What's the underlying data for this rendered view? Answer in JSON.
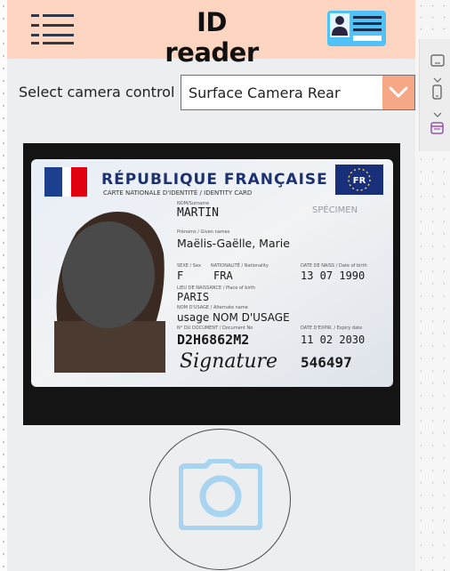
{
  "app": {
    "title": "ID reader"
  },
  "camera": {
    "label": "Select camera control",
    "selected": "Surface Camera Rear"
  },
  "card": {
    "country": "RÉPUBLIQUE FRANÇAISE",
    "card_type": "CARTE NATIONALE D'IDENTITÉ / IDENTITY CARD",
    "eu_badge": "FR",
    "specimen": "SPÉCIMEN",
    "surname_caption": "NOM/Surname",
    "surname": "MARTIN",
    "given_caption": "Prénoms / Given names",
    "given_names": "Maëlis-Gaëlle, Marie",
    "sex_caption": "SEXE / Sex",
    "sex": "F",
    "nationality_caption": "NATIONALITÉ / Nationality",
    "nationality": "FRA",
    "dob_caption": "DATE DE NAISS / Date of birth",
    "dob": "13 07 1990",
    "birthplace_caption": "LIEU DE NAISSANCE / Place of birth",
    "birthplace": "PARIS",
    "usage_caption": "NOM D'USAGE / Alternate name",
    "usage_name": "usage NOM D'USAGE",
    "docno_caption": "N° DU DOCUMENT / Document No",
    "doc_number": "D2H6862M2",
    "expiry_caption": "DATE D'EXPIR. / Expiry date",
    "expiry": "11 02 2030",
    "signature": "Signature",
    "can_number": "546497"
  },
  "colors": {
    "header_bg": "#fdd5c0",
    "accent": "#f6a786",
    "camera_icon": "#a8d4f0",
    "card_icon": "#4fc3f7"
  },
  "icons": {
    "menu": "hamburger-icon",
    "header_card": "id-card-icon",
    "dropdown": "chevron-down-icon",
    "capture": "camera-icon"
  }
}
